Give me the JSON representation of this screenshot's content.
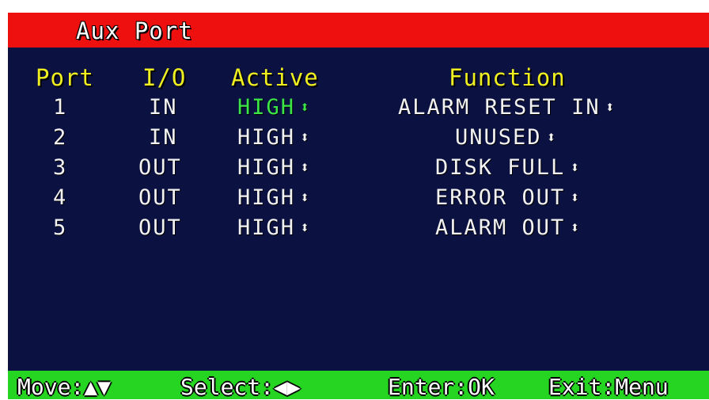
{
  "title": "Aux Port",
  "headers": {
    "port": "Port",
    "io": "I/O",
    "active": "Active",
    "function": "Function"
  },
  "rows": [
    {
      "port": "1",
      "io": "IN",
      "active": "HIGH",
      "function": "ALARM RESET IN",
      "active_arrows": "⬍",
      "function_arrows": "⬍"
    },
    {
      "port": "2",
      "io": "IN",
      "active": "HIGH",
      "function": "UNUSED",
      "active_arrows": "⬍",
      "function_arrows": "⬍"
    },
    {
      "port": "3",
      "io": "OUT",
      "active": "HIGH",
      "function": "DISK FULL",
      "active_arrows": "⬍",
      "function_arrows": "⬍"
    },
    {
      "port": "4",
      "io": "OUT",
      "active": "HIGH",
      "function": "ERROR OUT",
      "active_arrows": "⬍",
      "function_arrows": "⬍"
    },
    {
      "port": "5",
      "io": "OUT",
      "active": "HIGH",
      "function": "ALARM OUT",
      "active_arrows": "⬍",
      "function_arrows": "⬍"
    }
  ],
  "footer": {
    "move_label": "Move:",
    "move_arrows": "▲▼",
    "select_label": "Select:",
    "select_arrows": "◀▶",
    "enter_text": "Enter:OK",
    "exit_text": "Exit:Menu"
  },
  "colors": {
    "background": "#0b1242",
    "title_bar": "#ee0f0f",
    "header_text": "#f0f021",
    "selected_value": "#3ce646",
    "footer_bar": "#25d521"
  }
}
